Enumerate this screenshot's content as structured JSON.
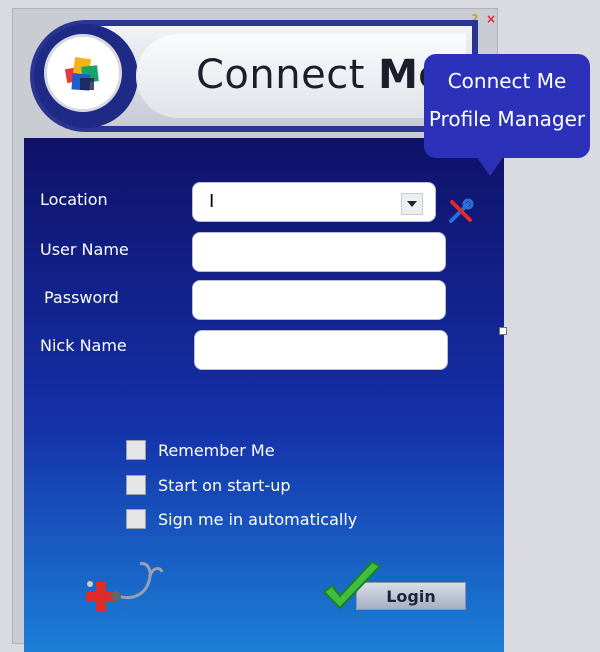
{
  "window": {
    "controls": {
      "help_glyph": "?",
      "close_glyph": "×"
    }
  },
  "header": {
    "brand_regular": "Connect ",
    "brand_bold": "Me",
    "logo_icon": "app-logo-icon"
  },
  "tooltip": {
    "line1": "Connect Me",
    "line2": "Profile Manager"
  },
  "form": {
    "location_label": "Location",
    "location_value": "I",
    "username_label": "User Name",
    "username_value": "",
    "password_label": "Password",
    "password_value": "",
    "nickname_label": "Nick Name",
    "nickname_value": ""
  },
  "options": [
    {
      "label": "Remember Me",
      "checked": false
    },
    {
      "label": "Start on start-up",
      "checked": false
    },
    {
      "label": "Sign me in automatically",
      "checked": false
    }
  ],
  "actions": {
    "login_label": "Login"
  },
  "colors": {
    "panel_top": "#0f1168",
    "panel_bottom": "#1b7fd6",
    "tooltip_bg": "#2b31b8",
    "header_border": "#2a3592"
  }
}
